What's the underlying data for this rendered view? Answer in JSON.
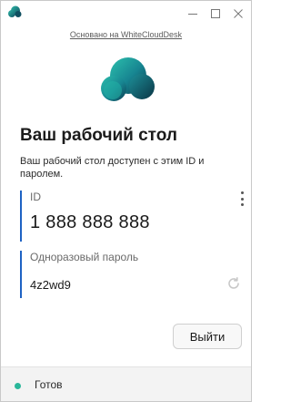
{
  "window": {
    "app_icon": "cloud-logo-icon",
    "controls": [
      "minimize-icon",
      "maximize-icon",
      "close-icon"
    ]
  },
  "powered_by": "Основано на WhiteCloudDesk",
  "logo": "cloud-logo",
  "heading": "Ваш рабочий стол",
  "description": "Ваш рабочий стол доступен с этим ID и паролем.",
  "id_section": {
    "label": "ID",
    "value": "1 888 888 888",
    "menu_icon": "more-vertical-icon"
  },
  "password_section": {
    "label": "Одноразовый пароль",
    "value": "4z2wd9",
    "refresh_icon": "refresh-icon"
  },
  "logout_label": "Выйти",
  "status": {
    "text": "Готов",
    "color": "#2ab79a"
  },
  "colors": {
    "accent": "#1e63c4",
    "logo_teal": "#1fa7a0",
    "logo_dark": "#0e4d5e"
  }
}
